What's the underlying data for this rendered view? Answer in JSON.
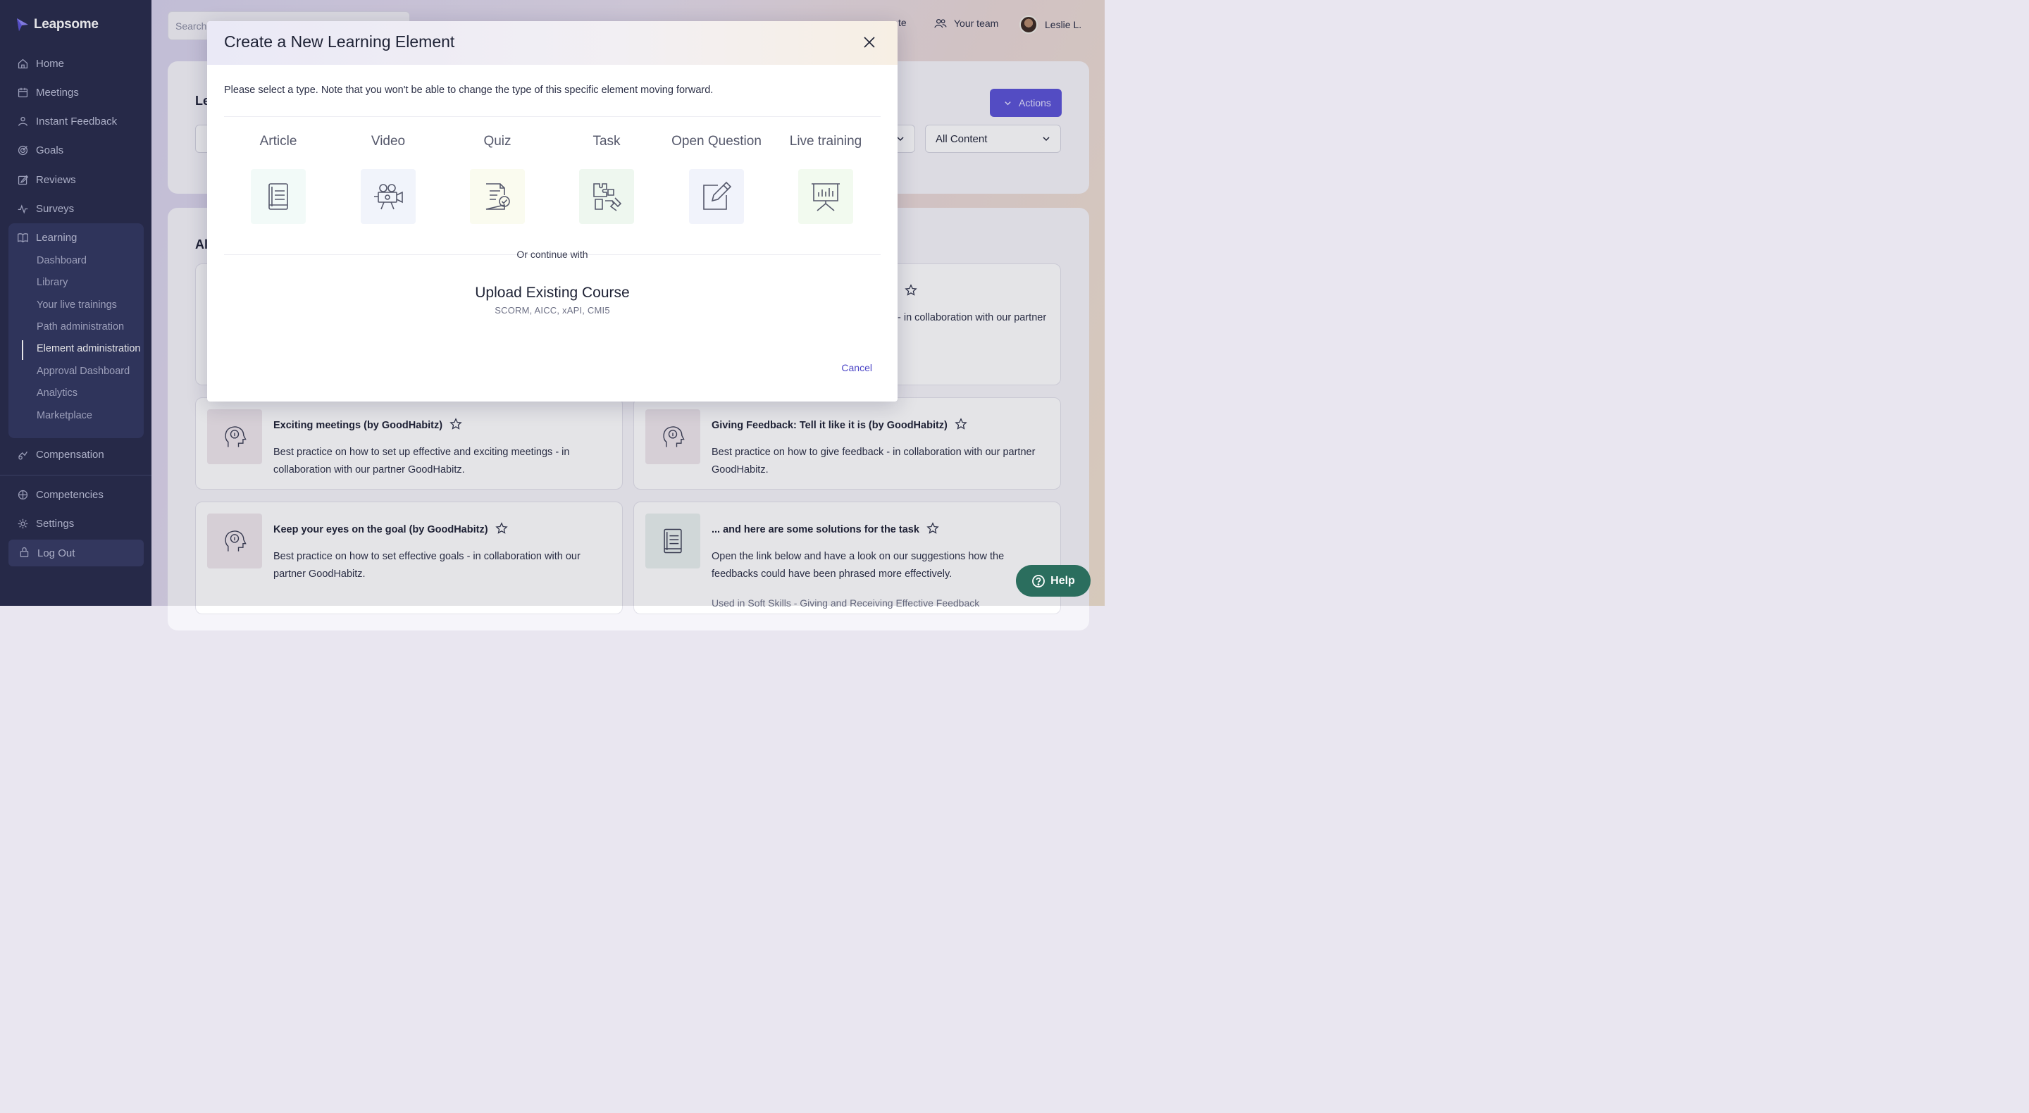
{
  "brand": {
    "name": "Leapsome"
  },
  "sidebar": {
    "items": [
      {
        "label": "Home",
        "icon": "home-icon"
      },
      {
        "label": "Meetings",
        "icon": "calendar-icon"
      },
      {
        "label": "Instant Feedback",
        "icon": "feedback-icon"
      },
      {
        "label": "Goals",
        "icon": "target-icon"
      },
      {
        "label": "Reviews",
        "icon": "edit-icon"
      },
      {
        "label": "Surveys",
        "icon": "pulse-icon"
      },
      {
        "label": "Learning",
        "icon": "book-icon"
      }
    ],
    "learning_sub": [
      {
        "label": "Dashboard"
      },
      {
        "label": "Library"
      },
      {
        "label": "Your live trainings"
      },
      {
        "label": "Path administration"
      },
      {
        "label": "Element administration"
      },
      {
        "label": "Approval Dashboard"
      },
      {
        "label": "Analytics"
      },
      {
        "label": "Marketplace"
      }
    ],
    "compensation": "Compensation",
    "competencies": "Competencies",
    "settings": "Settings",
    "logout": "Log Out"
  },
  "topbar": {
    "search_placeholder": "Search",
    "partial_item": "te",
    "team": "Your team",
    "user": "Leslie L."
  },
  "background": {
    "heading_partial_1": "Le",
    "heading_partial_2": "Al",
    "actions_label": "Actions",
    "filter_value": "All Content",
    "partial_desc": "- in collaboration with our partner",
    "tiles": [
      {
        "title": "Exciting meetings (by GoodHabitz)",
        "desc": "Best practice on how to set up effective and exciting meetings - in collaboration with our partner GoodHabitz."
      },
      {
        "title": "Giving Feedback: Tell it like it is (by GoodHabitz)",
        "desc": "Best practice on how to give feedback - in collaboration with our partner GoodHabitz."
      },
      {
        "title": "Keep your eyes on the goal (by GoodHabitz)",
        "desc": "Best practice on how to set effective goals - in collaboration with our partner GoodHabitz."
      },
      {
        "title": "... and here are some solutions for the task",
        "desc": "Open the link below and have a look on our suggestions how the feedbacks could have been phrased more effectively.",
        "footer": "Used in Soft Skills - Giving and Receiving Effective Feedback"
      }
    ]
  },
  "modal": {
    "title": "Create a New Learning Element",
    "intro": "Please select a type. Note that you won't be able to change the type of this specific element moving forward.",
    "types": [
      {
        "label": "Article",
        "icon": "article-icon",
        "bg": "#f2faf8"
      },
      {
        "label": "Video",
        "icon": "video-camera-icon",
        "bg": "#f1f4fb"
      },
      {
        "label": "Quiz",
        "icon": "quiz-icon",
        "bg": "#fafbef"
      },
      {
        "label": "Task",
        "icon": "puzzle-icon",
        "bg": "#eef7ef"
      },
      {
        "label": "Open Question",
        "icon": "pencil-square-icon",
        "bg": "#f1f3fb"
      },
      {
        "label": "Live training",
        "icon": "presentation-icon",
        "bg": "#f2faef"
      }
    ],
    "or_text": "Or continue with",
    "upload_title": "Upload Existing Course",
    "upload_formats": "SCORM, AICC, xAPI, CMI5",
    "cancel": "Cancel"
  },
  "help": {
    "label": "Help"
  }
}
